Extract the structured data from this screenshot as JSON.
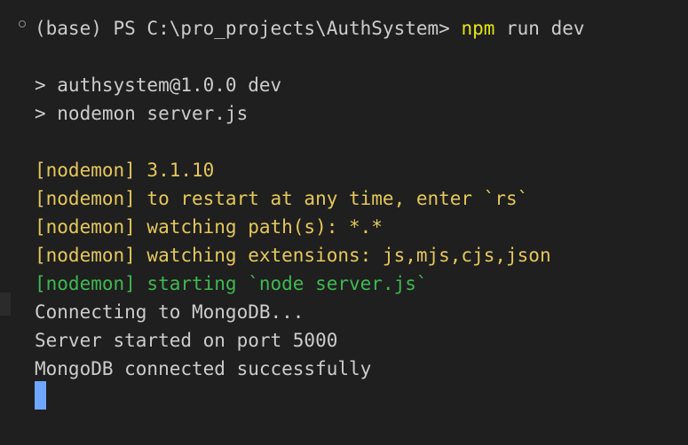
{
  "terminal": {
    "prompt": {
      "prefix": "(base) PS C:\\pro_projects\\AuthSystem> ",
      "command": "npm",
      "args": " run dev"
    },
    "script_header": [
      "> authsystem@1.0.0 dev",
      "> nodemon server.js"
    ],
    "nodemon_lines": [
      "[nodemon] 3.1.10",
      "[nodemon] to restart at any time, enter `rs`",
      "[nodemon] watching path(s): *.*",
      "[nodemon] watching extensions: js,mjs,cjs,json"
    ],
    "nodemon_start": "[nodemon] starting `node server.js`",
    "output": [
      "Connecting to MongoDB...",
      "Server started on port 5000",
      "MongoDB connected successfully"
    ]
  },
  "colors": {
    "background": "#1f1f1f",
    "text": "#cccccc",
    "command": "#e5e510",
    "nodemon_info": "#e5c85a",
    "nodemon_start": "#3fb950",
    "cursor": "#6ea7ff"
  }
}
